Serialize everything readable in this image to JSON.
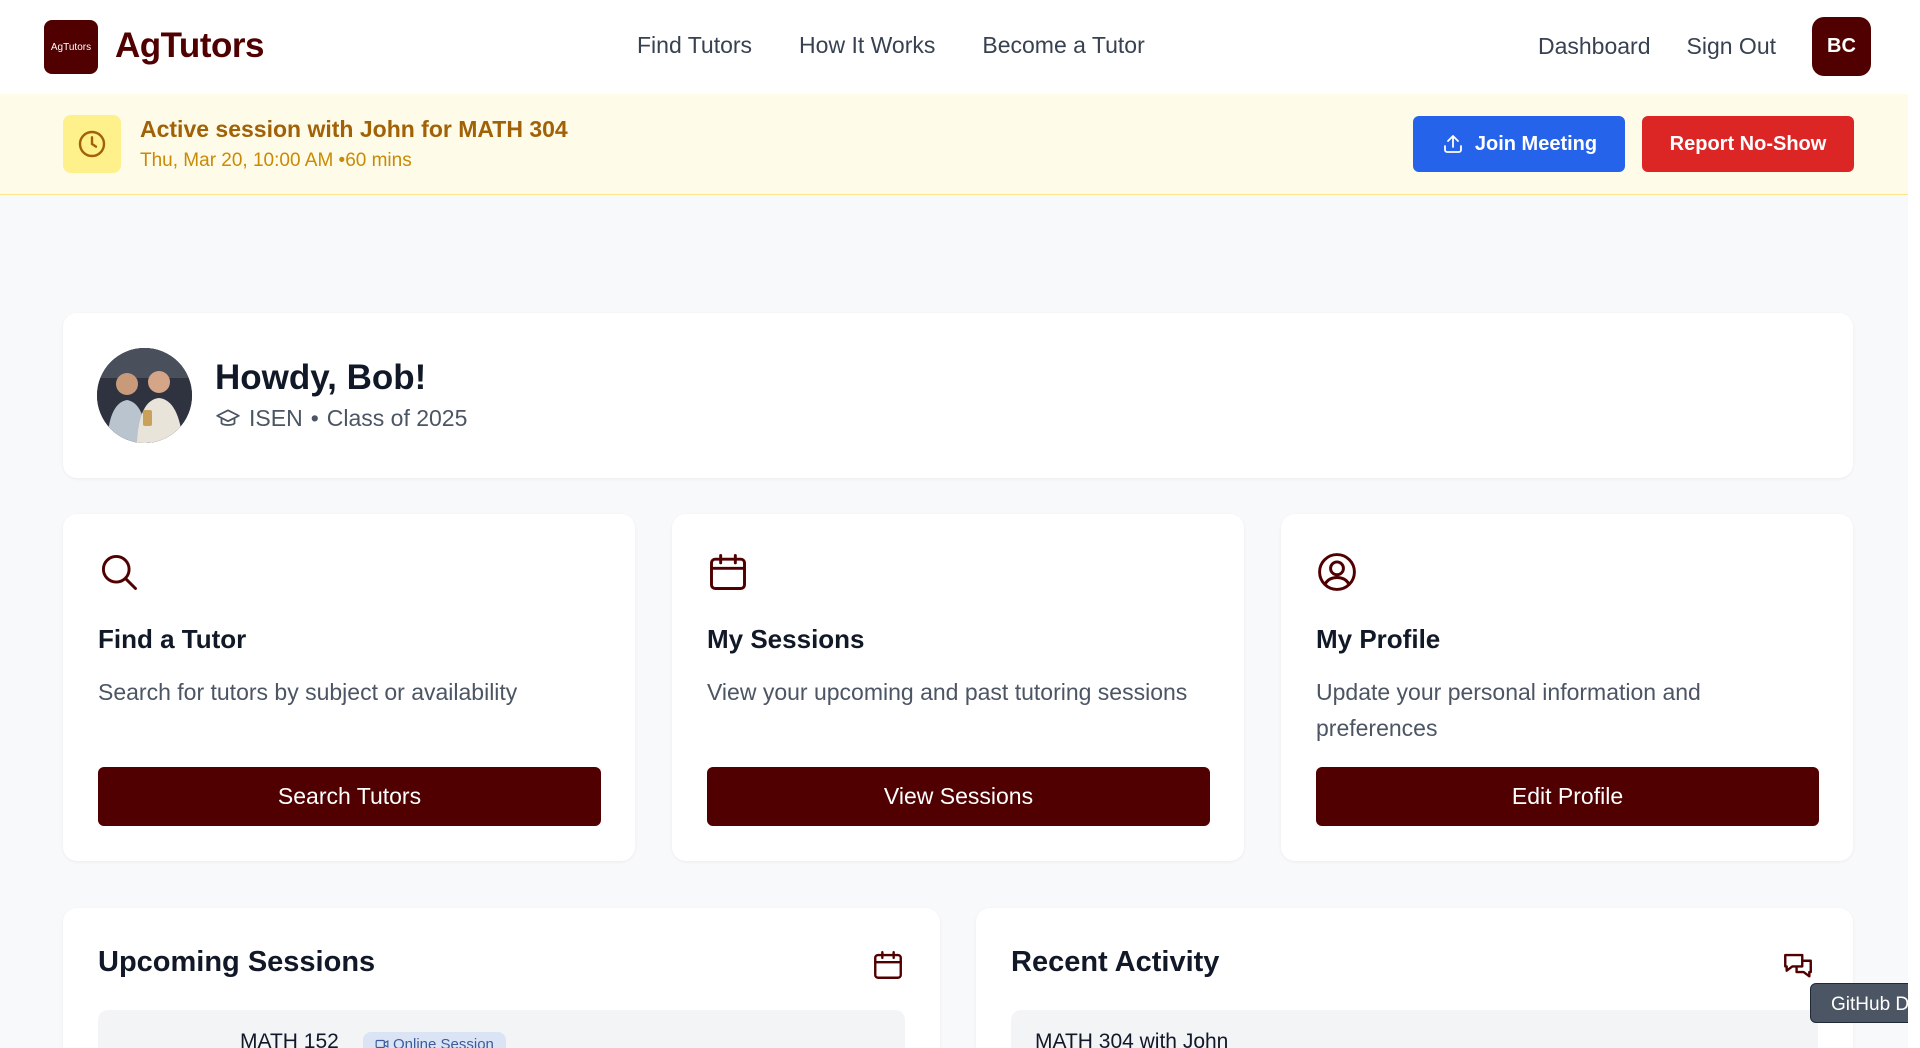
{
  "navbar": {
    "logo_text": "AgTutors",
    "brand": "AgTutors",
    "links": [
      "Find Tutors",
      "How It Works",
      "Become a Tutor"
    ],
    "dashboard": "Dashboard",
    "sign_out": "Sign Out",
    "avatar_initials": "BC"
  },
  "banner": {
    "title": "Active session with John for MATH 304",
    "subtitle": "Thu, Mar 20, 10:00 AM •60 mins",
    "join_label": "Join Meeting",
    "report_label": "Report No-Show"
  },
  "welcome": {
    "greeting": "Howdy, Bob!",
    "major": "ISEN",
    "separator": "•",
    "class_year": "Class of 2025"
  },
  "actions": [
    {
      "icon": "search-icon",
      "title": "Find a Tutor",
      "description": "Search for tutors by subject or availability",
      "button": "Search Tutors"
    },
    {
      "icon": "calendar-icon",
      "title": "My Sessions",
      "description": "View your upcoming and past tutoring sessions",
      "button": "View Sessions"
    },
    {
      "icon": "user-circle-icon",
      "title": "My Profile",
      "description": "Update your personal information and preferences",
      "button": "Edit Profile"
    }
  ],
  "upcoming": {
    "title": "Upcoming Sessions",
    "first_course": "MATH 152",
    "first_badge": "Online Session"
  },
  "activity": {
    "title": "Recent Activity",
    "first_item": "MATH 304 with John"
  },
  "tooltip": "GitHub De",
  "colors": {
    "brand": "#500000",
    "join": "#2563eb",
    "report": "#dc2626",
    "banner_bg": "#fefbe8"
  }
}
